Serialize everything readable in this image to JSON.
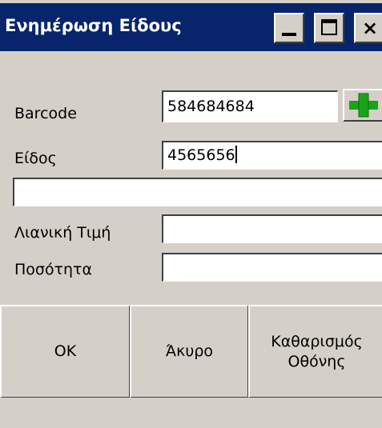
{
  "window": {
    "title": "Ενημέρωση Είδους",
    "controls": [
      "minimize-icon",
      "maximize-icon",
      "close-icon"
    ],
    "close_glyph": "×"
  },
  "form": {
    "barcode_label": "Barcode",
    "barcode_value": "584684684",
    "item_label": "Είδος",
    "item_value": "4565656",
    "item_description_value": "",
    "retail_price_label": "Λιανική Τιμή",
    "retail_price_value": "",
    "quantity_label": "Ποσότητα",
    "quantity_value": ""
  },
  "buttons": {
    "ok": "OK",
    "cancel": "Άκυρο",
    "clear_line1": "Καθαρισμός",
    "clear_line2": "Οθόνης"
  },
  "colors": {
    "titlebar": "#08246b",
    "background": "#d4d0c8",
    "add_icon": "#1aa31a"
  }
}
